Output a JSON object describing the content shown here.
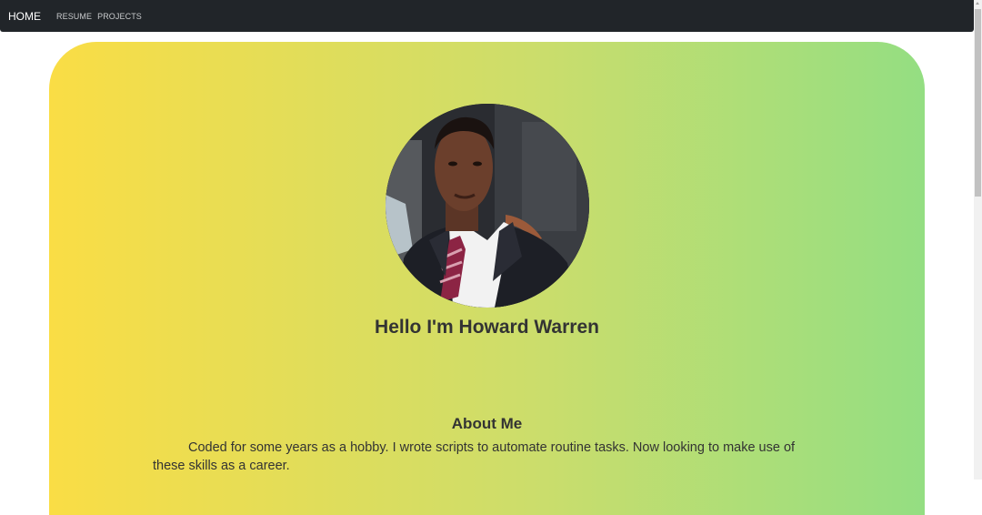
{
  "nav": {
    "brand": "HOME",
    "links": [
      "RESUME",
      "PROJECTS"
    ]
  },
  "hero": {
    "heading": "Hello I'm Howard Warren"
  },
  "about": {
    "title": "About Me",
    "text": "Coded for some years as a hobby. I wrote scripts to automate routine tasks. Now looking to make use of these skills as a career."
  },
  "colors": {
    "nav_bg": "#212529",
    "gradient_start": "#fadd45",
    "gradient_end": "#94de82"
  }
}
